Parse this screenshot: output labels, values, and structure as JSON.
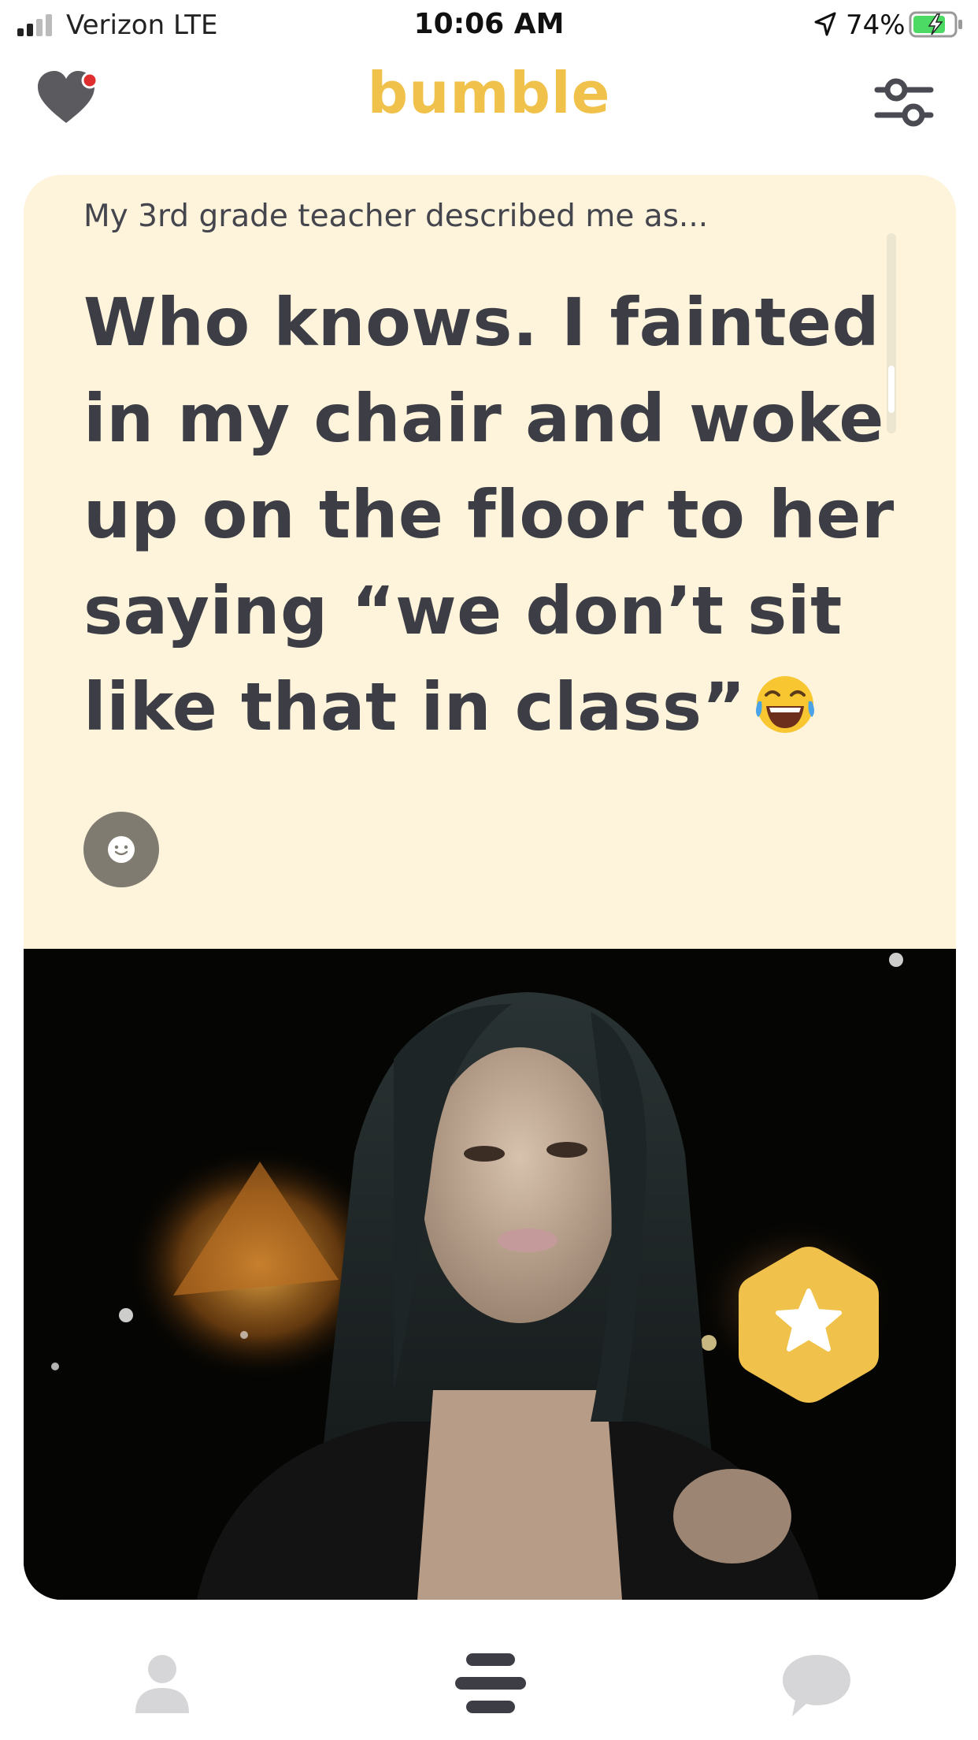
{
  "status_bar": {
    "carrier": "Verizon  LTE",
    "time": "10:06 AM",
    "battery": "74%"
  },
  "header": {
    "logo": "bumble",
    "brand_color": "#f0c24b",
    "left_icon": "heart-icon",
    "right_icon": "filter-icon"
  },
  "card": {
    "prompt_question": "My 3rd grade teacher described me as...",
    "prompt_answer": "Who knows. I fainted in my chair and woke up on the floor to her saying “we don’t sit like that in class”",
    "answer_emoji": "face-with-tears-of-joy",
    "background_color": "#fdf4db",
    "react_icon": "smiley-icon",
    "photo_icon": "profile-photo",
    "superswipe_icon": "star-icon"
  },
  "bottom_nav": {
    "items": [
      {
        "icon": "profile-icon"
      },
      {
        "icon": "discover-icon"
      },
      {
        "icon": "chat-icon"
      }
    ]
  }
}
